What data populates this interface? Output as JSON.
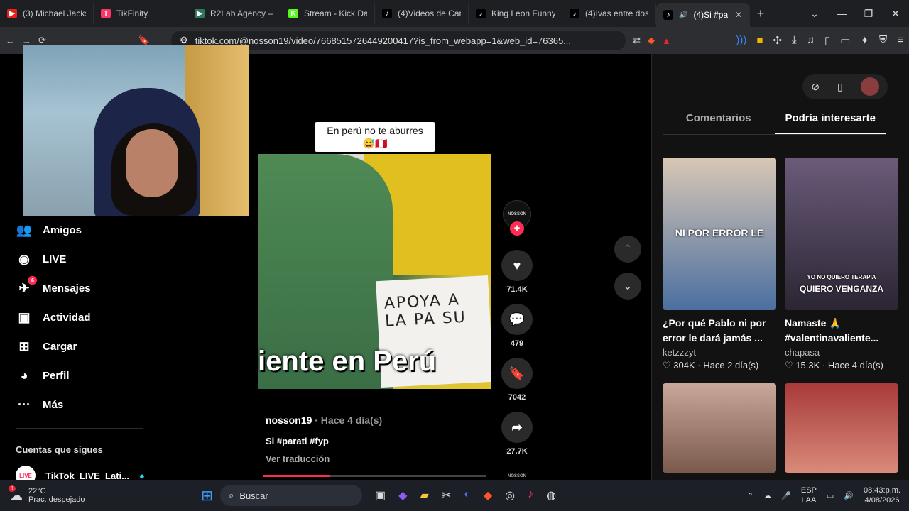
{
  "browser": {
    "tabs": [
      {
        "title": "(3) Michael Jacks",
        "fav_color": "#e62117",
        "fav": "▶"
      },
      {
        "title": "TikFinity",
        "fav_color": "#ff3366",
        "fav": "T"
      },
      {
        "title": "R2Lab Agency —",
        "fav_color": "#2d7a5a",
        "fav": "▶"
      },
      {
        "title": "Stream - Kick Da",
        "fav_color": "#53fc18",
        "fav": "K"
      },
      {
        "title": "(4)Videos de Car",
        "fav_color": "#000000",
        "fav": "♪"
      },
      {
        "title": "King Leon Funny",
        "fav_color": "#000000",
        "fav": "♪"
      },
      {
        "title": "(4)Ivas entre dos",
        "fav_color": "#000000",
        "fav": "♪"
      },
      {
        "title": "(4)Si #pa",
        "fav_color": "#000000",
        "fav": "♪"
      }
    ],
    "url": "tiktok.com/@nosson19/video/7668515726449200417?is_from_webapp=1&web_id=76365..."
  },
  "sidebar": {
    "items": [
      {
        "label": "Amigos",
        "icon": "friends-icon",
        "glyph": "👥"
      },
      {
        "label": "LIVE",
        "icon": "live-icon",
        "glyph": "◉"
      },
      {
        "label": "Mensajes",
        "icon": "messages-icon",
        "glyph": "✈",
        "badge": "4"
      },
      {
        "label": "Actividad",
        "icon": "activity-icon",
        "glyph": "▣"
      },
      {
        "label": "Cargar",
        "icon": "upload-icon",
        "glyph": "⊞"
      },
      {
        "label": "Perfil",
        "icon": "profile-icon",
        "glyph": "◕"
      },
      {
        "label": "Más",
        "icon": "more-icon",
        "glyph": "···"
      }
    ],
    "following_title": "Cuentas que sigues",
    "following_account": "TikTok_LIVE_Lati..."
  },
  "video": {
    "overlay_text": "En perú no te aburres",
    "overlay_emoji": "😅🇵🇪",
    "caption": "iente en Perú",
    "sign_text": "APOYA A LA PA SU",
    "author_avatar_text": "NOSSON",
    "likes": "71.4K",
    "comments": "479",
    "saves": "7042",
    "shares": "27.7K",
    "author": "nosson19",
    "time_ago": "· Hace 4 día(s)",
    "description": "Si #parati  #fyp",
    "translate": "Ver traducción",
    "progress": 0.3,
    "next_avatar_text": "NOSSON"
  },
  "right_panel": {
    "tabs": [
      "Comentarios",
      "Podría interesarte"
    ],
    "cards": [
      {
        "title": "¿Por qué Pablo ni por error le dará jamás ...",
        "author": "ketzzzyt",
        "likes": "304K",
        "time": "Hace 2 día(s)",
        "thumb_text": "NI POR ERROR LE",
        "colors": [
          "#d9c7b5",
          "#4a6fa0"
        ]
      },
      {
        "title": "Namaste 🙏 #valentinavaliente...",
        "author": "chapasa",
        "likes": "15.3K",
        "time": "Hace 4 día(s)",
        "thumb_text": "QUIERO VENGANZA",
        "thumb_sub": "YO NO QUIERO TERAPIA",
        "colors": [
          "#6b5b7a",
          "#2b2533"
        ]
      },
      {
        "title": "",
        "author": "",
        "likes": "",
        "time": "",
        "thumb_text": "",
        "colors": [
          "#c9a79a",
          "#7a5a4c"
        ]
      },
      {
        "title": "",
        "author": "",
        "likes": "",
        "time": "",
        "thumb_text": "",
        "colors": [
          "#a83a3a",
          "#d98a7a"
        ]
      }
    ]
  },
  "taskbar": {
    "temp": "22°C",
    "weather": "Prac. despejado",
    "weather_badge": "1",
    "search": "Buscar",
    "lang1": "ESP",
    "lang2": "LAA",
    "time": "08:43:p.m.",
    "date": "4/08/2026"
  }
}
